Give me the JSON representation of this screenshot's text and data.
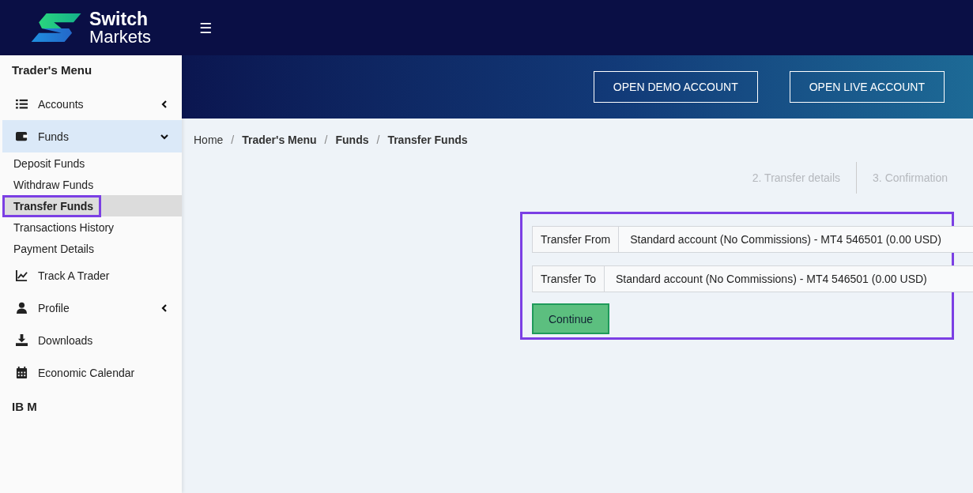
{
  "header": {
    "logo_top": "Switch",
    "logo_bottom": "Markets",
    "menu_toggle": "☰"
  },
  "sidebar": {
    "title": "Trader's Menu",
    "items": [
      {
        "kind": "menu",
        "label": "Accounts",
        "expanded": false,
        "selected": false
      },
      {
        "kind": "menu",
        "label": "Funds",
        "expanded": true,
        "selected": true
      },
      {
        "kind": "sub",
        "label": "Deposit Funds",
        "selected": false,
        "highlighted": false
      },
      {
        "kind": "sub",
        "label": "Withdraw Funds",
        "selected": false,
        "highlighted": false
      },
      {
        "kind": "sub",
        "label": "Transfer Funds",
        "selected": true,
        "highlighted": true
      },
      {
        "kind": "sub",
        "label": "Transactions History",
        "selected": false,
        "highlighted": false
      },
      {
        "kind": "sub",
        "label": "Payment Details",
        "selected": false,
        "highlighted": false
      },
      {
        "kind": "link",
        "label": "Track A Trader",
        "selected": false
      },
      {
        "kind": "menu",
        "label": "Profile",
        "expanded": false,
        "selected": false
      },
      {
        "kind": "link",
        "label": "Downloads",
        "selected": false
      },
      {
        "kind": "link",
        "label": "Economic Calendar",
        "selected": false
      },
      {
        "kind": "heading",
        "label": "IB M"
      }
    ]
  },
  "banner": {
    "buttons": [
      "OPEN DEMO ACCOUNT",
      "OPEN LIVE ACCOUNT"
    ]
  },
  "breadcrumb": [
    {
      "kind": "link",
      "label": "Home",
      "current": false
    },
    {
      "kind": "separator",
      "label": "/"
    },
    {
      "kind": "link",
      "label": "Trader's Menu",
      "current": true
    },
    {
      "kind": "separator",
      "label": "/"
    },
    {
      "kind": "link",
      "label": "Funds",
      "current": true
    },
    {
      "kind": "separator",
      "label": "/"
    },
    {
      "kind": "link",
      "label": "Transfer Funds",
      "current": true
    }
  ],
  "steps": [
    {
      "label": "2. Transfer details",
      "active": false
    },
    {
      "label": "3. Confirmation",
      "active": false
    }
  ],
  "form": {
    "highlighted": true,
    "fields": [
      {
        "label": "Transfer From",
        "value": "Standard account (No Commissions) - MT4 546501 (0.00 USD)"
      },
      {
        "label": "Transfer To",
        "value": "Standard account (No Commissions) - MT4 546501 (0.00 USD)"
      }
    ],
    "button": "Continue"
  }
}
